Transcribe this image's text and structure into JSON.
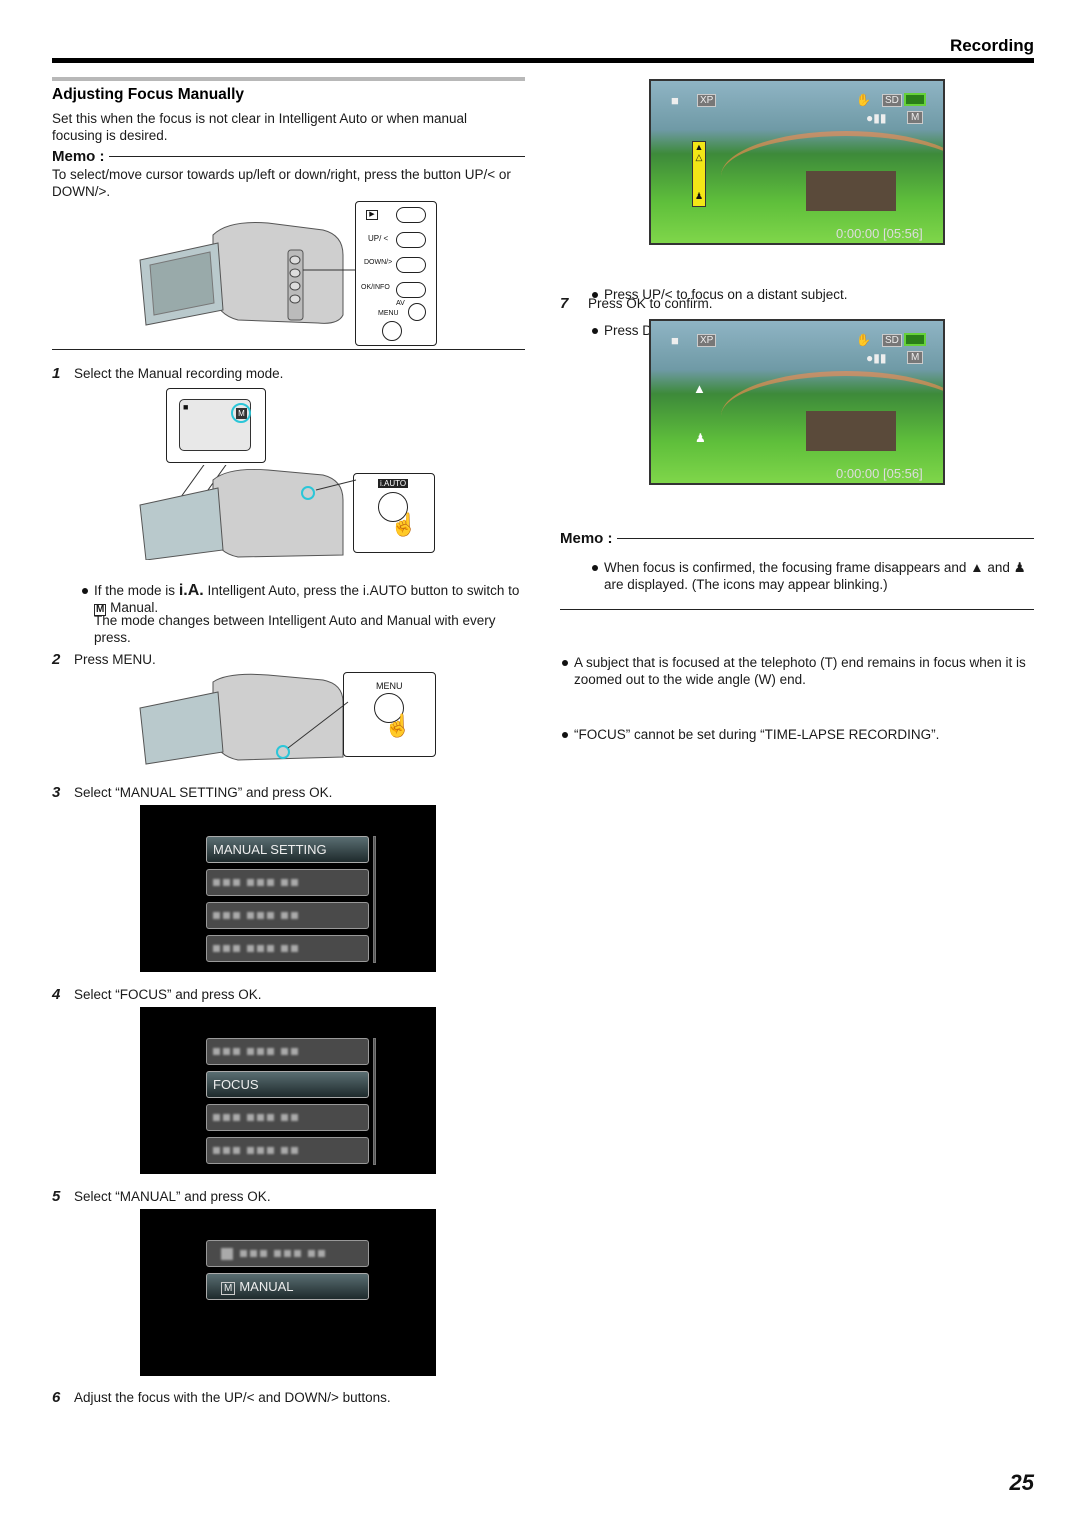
{
  "header": {
    "section": "Recording"
  },
  "page_number": "25",
  "left": {
    "title": "Adjusting Focus Manually",
    "intro": "Set this when the focus is not clear in Intelligent Auto or when manual focusing is desired.",
    "memo_label": "Memo :",
    "memo_text": "To select/move cursor towards up/left or down/right, press the button UP/< or DOWN/>.",
    "buttons_panel": {
      "play": "▶",
      "up": "UP/ <",
      "down": "DOWN/>",
      "ok": "OK/INFO",
      "av": "AV",
      "menu": "MENU"
    },
    "steps": [
      {
        "num": "1",
        "text": "Select the Manual recording mode."
      },
      {
        "num": "2",
        "text": "Press MENU."
      },
      {
        "num": "3",
        "text": "Select “MANUAL SETTING” and press OK."
      },
      {
        "num": "4",
        "text": "Select “FOCUS” and press OK."
      },
      {
        "num": "5",
        "text": "Select “MANUAL” and press OK."
      },
      {
        "num": "6",
        "text": "Adjust the focus with the UP/< and DOWN/> buttons."
      }
    ],
    "step1_note": {
      "bullet_a": "If the mode is",
      "ia_icon": "i.A.",
      "bullet_b": "Intelligent Auto, press the i.AUTO button to switch to",
      "m_icon": "M",
      "bullet_c": "Manual.",
      "extra": "The mode changes between Intelligent Auto and Manual with every press."
    },
    "iauto_label": "i.AUTO",
    "menu_label": "MENU",
    "menu1": {
      "items": [
        "MANUAL SETTING",
        "",
        "",
        ""
      ],
      "selected": 0
    },
    "menu2": {
      "items": [
        "",
        "FOCUS",
        "",
        ""
      ],
      "selected": 1
    },
    "menu3": {
      "items": [
        "",
        "MANUAL"
      ],
      "selected": 1,
      "manual_icon": "M"
    }
  },
  "right": {
    "osd": {
      "mode": "XP",
      "card": "SD",
      "mode_icon": "M",
      "time": "0:00:00",
      "remaining": "[05:56]"
    },
    "bullets_step6": [
      "Press UP/< to focus on a distant subject.",
      "Press DOWN/> to focus on a near subject."
    ],
    "step7": {
      "num": "7",
      "text": "Press OK to confirm."
    },
    "confirm_note_a": "When focus is confirmed, the focusing frame disappears and",
    "confirm_note_b": "and",
    "confirm_note_c": "are displayed. (The icons may appear blinking.)",
    "memo_label": "Memo :",
    "memo_bullets": [
      "A subject that is focused at the telephoto (T) end remains in focus when it is zoomed out to the wide angle (W) end.",
      "“FOCUS” cannot be set during “TIME-LAPSE RECORDING”."
    ]
  }
}
